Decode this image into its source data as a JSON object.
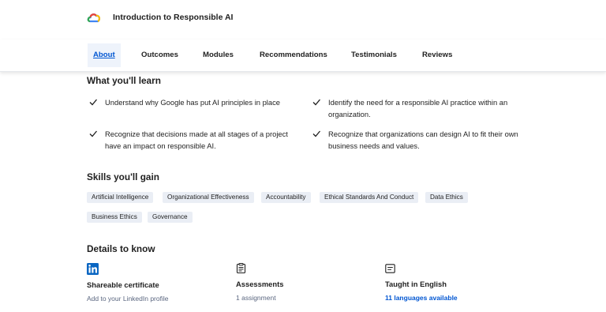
{
  "header": {
    "title": "Introduction to Responsible AI",
    "logo_icon": "google-cloud-icon"
  },
  "nav": {
    "items": [
      {
        "label": "About",
        "active": true
      },
      {
        "label": "Outcomes"
      },
      {
        "label": "Modules"
      },
      {
        "label": "Recommendations"
      },
      {
        "label": "Testimonials"
      },
      {
        "label": "Reviews"
      }
    ]
  },
  "learn": {
    "title": "What you'll learn",
    "items": [
      "Understand why Google has put AI principles in place",
      "Identify the need for a responsible AI practice within an organization.",
      "Recognize that decisions made at all stages of a project have an impact on responsible AI.",
      "Recognize that organizations can design AI to fit their own business needs and values."
    ]
  },
  "skills": {
    "title": "Skills you'll gain",
    "tags": [
      "Artificial Intelligence",
      "Organizational Effectiveness",
      "Accountability",
      "Ethical Standards And Conduct",
      "Data Ethics",
      "Business Ethics",
      "Governance"
    ]
  },
  "details": {
    "title": "Details to know",
    "items": [
      {
        "icon": "linkedin-icon",
        "title": "Shareable certificate",
        "sub": "Add to your LinkedIn profile"
      },
      {
        "icon": "assessment-icon",
        "title": "Assessments",
        "sub": "1 assignment"
      },
      {
        "icon": "language-icon",
        "title": "Taught in English",
        "link": "11 languages available"
      }
    ]
  },
  "colors": {
    "accent": "#0056d2",
    "tag_bg": "#eaeef5",
    "linkedin": "#0a66c2"
  }
}
